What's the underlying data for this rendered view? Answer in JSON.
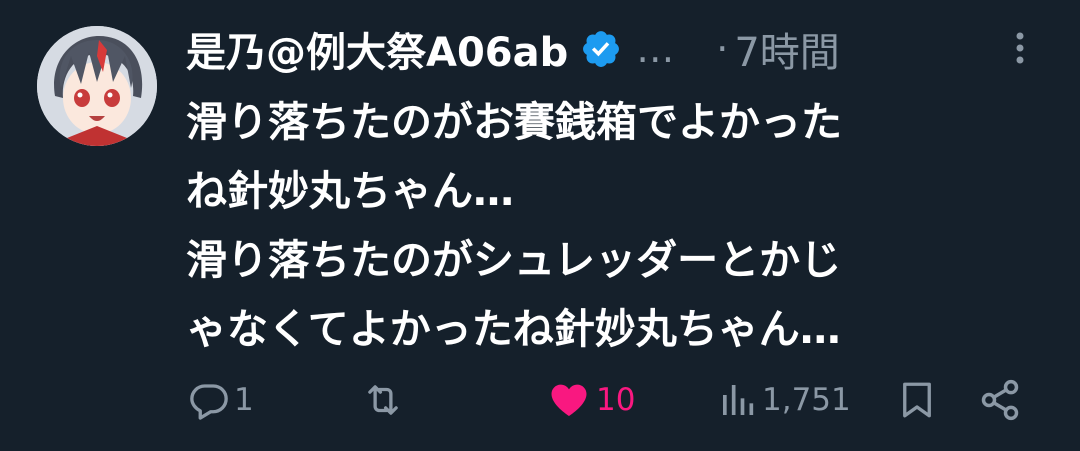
{
  "tweet": {
    "display_name": "是乃@例大祭A06ab",
    "handle_truncated": "…",
    "separator": "·",
    "time": "7時間",
    "body": "滑り落ちたのがお賽銭箱でよかった\nね針妙丸ちゃん…\n滑り落ちたのがシュレッダーとかじ\nゃなくてよかったね針妙丸ちゃん…"
  },
  "actions": {
    "reply_count": "1",
    "retweet_count": "",
    "like_count": "10",
    "view_count": "1,751"
  },
  "icons": {
    "verified": "verified-badge-icon",
    "more": "more-vertical-icon",
    "reply": "reply-icon",
    "retweet": "retweet-icon",
    "like": "heart-icon",
    "views": "views-icon",
    "bookmark": "bookmark-icon",
    "share": "share-icon"
  },
  "colors": {
    "background": "#15202b",
    "text_primary": "#ffffff",
    "text_secondary": "#8b98a5",
    "verified_blue": "#1d9bf0",
    "like_pink": "#f91880"
  }
}
